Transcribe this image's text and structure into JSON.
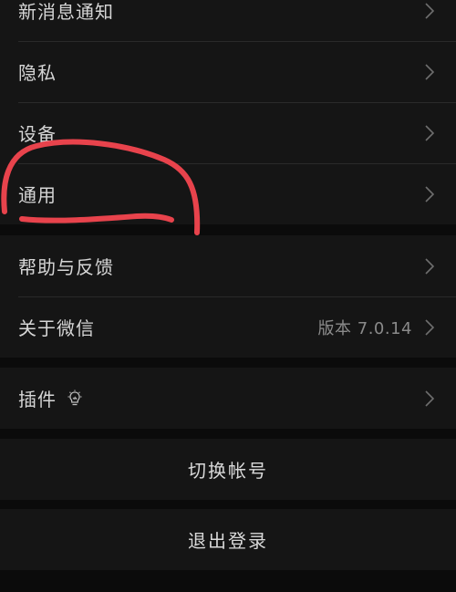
{
  "settings": {
    "group1": [
      {
        "label": "新消息通知"
      },
      {
        "label": "隐私"
      },
      {
        "label": "设备"
      },
      {
        "label": "通用"
      }
    ],
    "group2": [
      {
        "label": "帮助与反馈"
      },
      {
        "label": "关于微信",
        "value": "版本 7.0.14"
      }
    ],
    "group3": [
      {
        "label": "插件",
        "icon": "lightbulb-icon"
      }
    ]
  },
  "actions": {
    "switch_account": "切换帐号",
    "logout": "退出登录"
  },
  "colors": {
    "background": "#0b0b0b",
    "cell": "#151515",
    "text": "#d6d6d6",
    "secondary_text": "#8a8a8a",
    "annotation": "#e8434c"
  },
  "icons": {
    "chevron": "chevron-right-icon",
    "plugin": "lightbulb-icon"
  }
}
